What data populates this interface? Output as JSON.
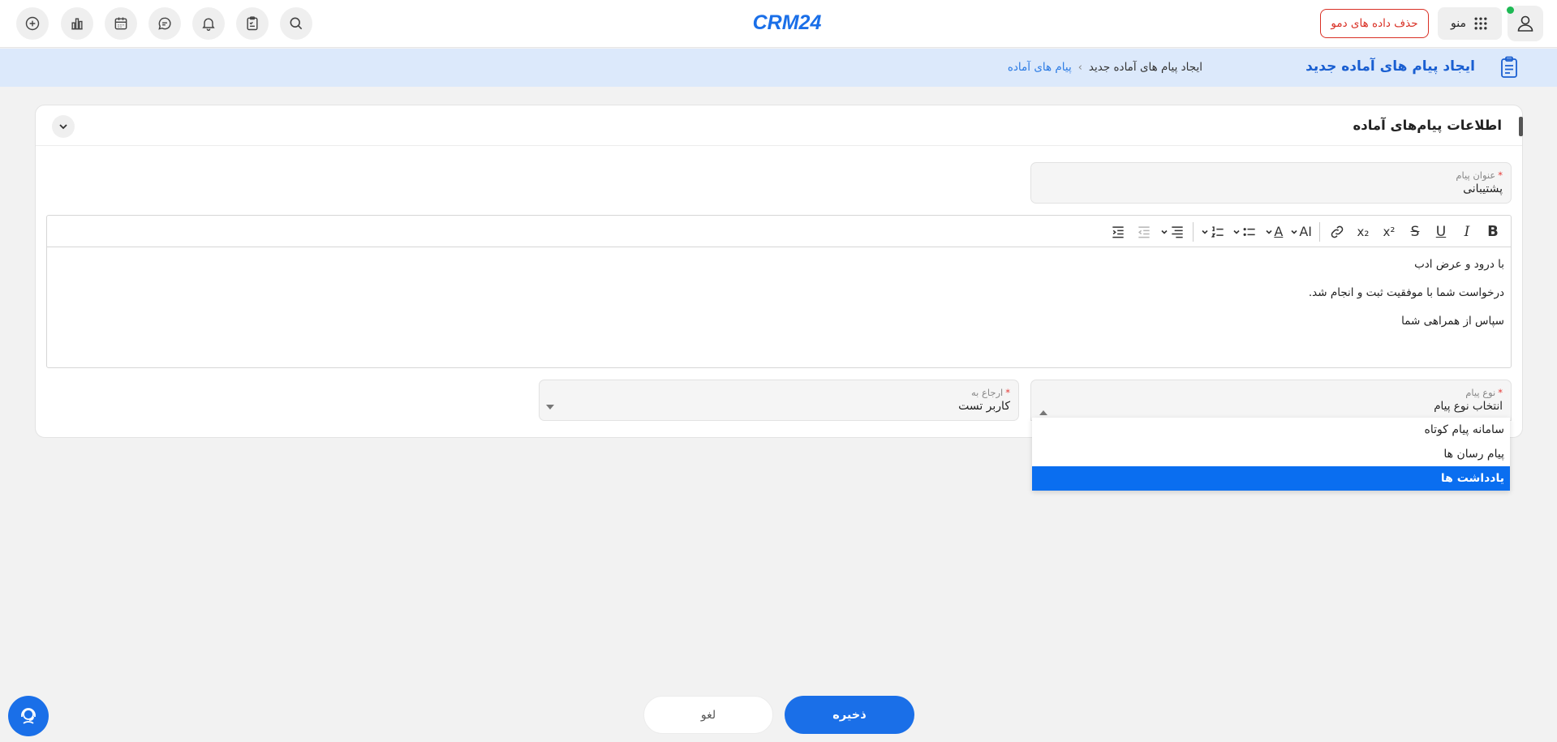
{
  "topbar": {
    "logo_text": "CRM24",
    "demo_button_label": "حذف داده های دمو",
    "menu_label": "منو",
    "icons": [
      "plus-circle-icon",
      "chart-bar-icon",
      "calendar-icon",
      "chat-icon",
      "bell-icon",
      "clipboard-check-icon",
      "search-icon",
      "grid-menu-icon",
      "user-icon"
    ]
  },
  "page_header": {
    "title": "ایجاد پیام های آماده جدید",
    "breadcrumb": {
      "link": "پیام های آماده",
      "separator": "›",
      "current": "ایجاد پیام های آماده جدید"
    }
  },
  "card": {
    "title": "اطلاعات پیام‌های آماده",
    "subject": {
      "label": "عنوان پیام",
      "required": "*",
      "value": "پشتیبانی"
    },
    "editor": {
      "lines": [
        "با درود و عرض ادب",
        "درخواست شما با موفقیت ثبت و انجام شد.",
        "سپاس از همراهی شما"
      ],
      "toolbar": {
        "bold": "B",
        "italic": "I",
        "underline": "U",
        "strike": "S",
        "superscript": "x²",
        "subscript": "x₂",
        "font_size": "AI",
        "font_color": "A"
      }
    },
    "message_type": {
      "label": "نوع پیام",
      "required": "*",
      "placeholder": "انتخاب نوع پیام",
      "options": [
        "سامانه پیام کوتاه",
        "پیام رسان ها",
        "یادداشت ها"
      ],
      "highlighted": "یادداشت ها"
    },
    "refer_to": {
      "label": "ارجاع به",
      "required": "*",
      "value": "کاربر تست"
    }
  },
  "footer": {
    "save_label": "ذخیره",
    "cancel_label": "لغو"
  },
  "colors": {
    "primary": "#1a6fe8",
    "danger": "#d93025",
    "header_bg": "#dce9fb",
    "online": "#1db954"
  }
}
